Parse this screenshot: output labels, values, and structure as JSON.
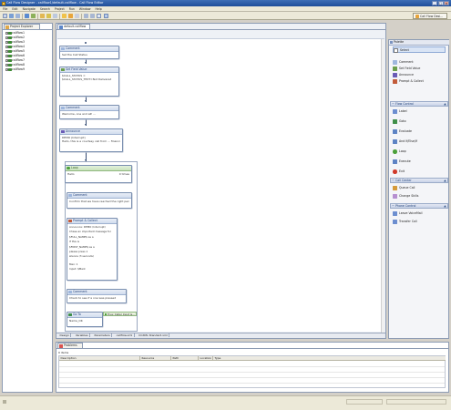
{
  "window": {
    "title": "Call Flow Designer - callflow1/default.callflow - Call Flow Editor",
    "min": "_",
    "max": "□",
    "close": "×"
  },
  "menu": [
    "File",
    "Edit",
    "Navigate",
    "Search",
    "Project",
    "Run",
    "Window",
    "Help"
  ],
  "toolbar": {
    "perspective_label": "Call Flow Desi..."
  },
  "explorer": {
    "tab_label": "Project Explorer",
    "items": [
      "callflow1",
      "callflow2",
      "callflow3",
      "callflow4",
      "callflow5",
      "callflow6",
      "callflow7",
      "callflow8",
      "callflow9"
    ]
  },
  "editor": {
    "tab_label": "default.callflow",
    "bottom_tabs": [
      "Design",
      "Variables",
      "Parameters",
      "callflow.xml",
      "CCXML Standard.xml"
    ]
  },
  "flow": {
    "n1": {
      "title": "Comment",
      "body": [
        "Set the Call Status"
      ]
    },
    "n2": {
      "title": "Set Field Value",
      "body": [
        "$CALL_STATUS =",
        "$CALL_STATUS_TEXT=Not Delivered"
      ]
    },
    "n3": {
      "title": "Comment",
      "body": [
        "Welcome, one and all! ..."
      ]
    },
    "n4": {
      "title": "Announce",
      "body": [
        "DEMO (Interrupt)",
        "Hello, this is a courtesy call from ... financial"
      ]
    },
    "loop": {
      "title": "Loop",
      "body_left": "Hello",
      "body_right": "0 times"
    },
    "n5": {
      "title": "Comment",
      "body": [
        "Confirm that we have reached the right person ..."
      ]
    },
    "n6": {
      "title": "Prompt & Collect",
      "body": [
        "Announce:   DEMO (Interrupt)",
        "  Chase an important message for",
        "  $FULL_NAME$ as a",
        "  If this is",
        "  $FIRST_NAME$ as a",
        "  please press 1",
        "  silence (3 seconds)",
        "",
        "  Max: 1",
        "  Input:            $Mark"
      ]
    },
    "n7": {
      "title": "Comment",
      "body": [
        "Check to see if a one was pressed"
      ]
    },
    "n8": {
      "title": "Go To",
      "body": [
        "Name_OK"
      ],
      "side_label": "True: Caller Input is..."
    }
  },
  "palette": {
    "tab_label": "Palette",
    "select": "Select",
    "items_top": [
      "Comment",
      "Set Field Value",
      "Announce",
      "Prompt & Collect"
    ],
    "groups": [
      "Flow Control",
      "Call Center",
      "Phone Control"
    ],
    "flow_control": [
      "Label",
      "Goto",
      "Evaluate",
      "And If/Else/If",
      "Loop",
      "Execute",
      "Exit"
    ],
    "call_center": [
      "Queue Call",
      "Change Skills"
    ],
    "phone_control": [
      "Leave VoiceMail",
      "Transfer Call"
    ]
  },
  "problems": {
    "tab_label": "Problems",
    "count": "0 items",
    "columns": [
      "Description",
      "Resource",
      "Path",
      "Location",
      "Type"
    ]
  }
}
